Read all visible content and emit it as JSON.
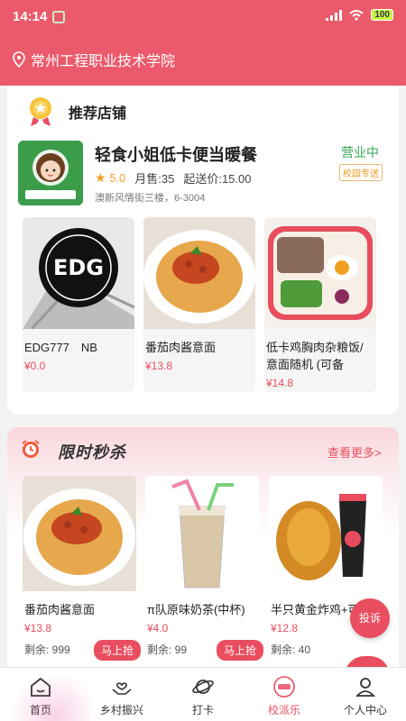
{
  "status_bar": {
    "time": "14:14",
    "battery": "100"
  },
  "location": {
    "school": "常州工程职业技术学院"
  },
  "recommend": {
    "title": "推荐店铺",
    "shop": {
      "name": "轻食小姐低卡便当暖餐",
      "status": "营业中",
      "tag": "校园专送",
      "rating": "5.0",
      "monthly_sales": "月售:35",
      "min_delivery": "起送价:15.00",
      "address": "澳新风情街三楼，6-3004"
    },
    "products": [
      {
        "name": "EDG777　NB",
        "price": "¥0.0"
      },
      {
        "name": "番茄肉酱意面",
        "price": "¥13.8"
      },
      {
        "name": "低卡鸡胸肉杂粮饭/意面随机 (可备",
        "price": "¥14.8"
      }
    ]
  },
  "flash_sale": {
    "title": "限时秒杀",
    "more": "查看更多>",
    "buy_label": "马上抢",
    "items": [
      {
        "name": "番茄肉酱意面",
        "price": "¥13.8",
        "stock": "剩余: 999"
      },
      {
        "name": "π队原味奶茶(中杯)",
        "price": "¥4.0",
        "stock": "剩余: 99"
      },
      {
        "name": "半只黄金炸鸡+可乐",
        "price": "¥12.8",
        "stock": "剩余: 40"
      }
    ]
  },
  "complaint_label": "投诉",
  "tabbar": [
    {
      "label": "首页",
      "icon": "home-icon"
    },
    {
      "label": "乡村振兴",
      "icon": "hands-heart-icon"
    },
    {
      "label": "打卡",
      "icon": "planet-icon"
    },
    {
      "label": "校派乐",
      "icon": "campus-badge-icon"
    },
    {
      "label": "个人中心",
      "icon": "user-icon"
    }
  ],
  "colors": {
    "brand": "#ea5a6a",
    "accent": "#e94e60",
    "open_green": "#3aa657",
    "rating": "#f3a21f"
  }
}
